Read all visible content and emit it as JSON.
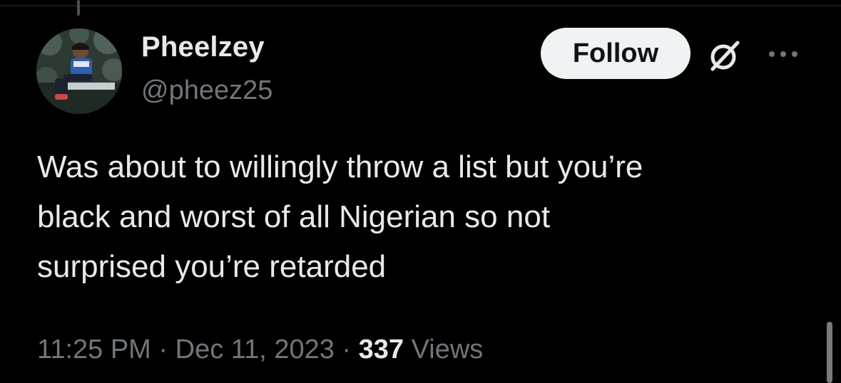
{
  "author": {
    "display_name": "Pheelzey",
    "handle": "@pheez25",
    "avatar_icon": "avatar-image"
  },
  "actions": {
    "follow_label": "Follow",
    "grok_icon": "grok-icon",
    "more_icon": "more-options-icon"
  },
  "tweet": {
    "text": "Was about to willingly throw a list but you’re\nblack and worst of all Nigerian so not\nsurprised you’re retarded",
    "time": "11:25 PM",
    "separator": "·",
    "date": "Dec 11, 2023",
    "views_count": "337",
    "views_label": "Views"
  },
  "colors": {
    "background": "#000000",
    "primary_text": "#e7e9ea",
    "secondary_text": "#71767b",
    "follow_bg": "#eff3f4",
    "follow_text": "#0f1419"
  }
}
